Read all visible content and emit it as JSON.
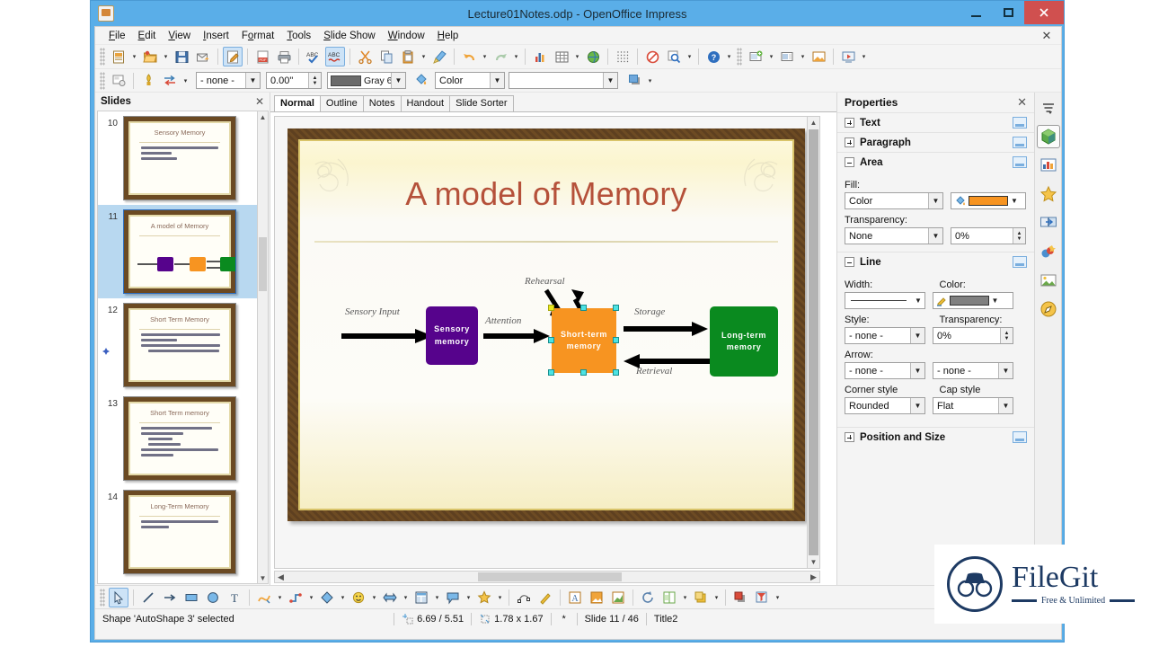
{
  "window": {
    "title": "Lecture01Notes.odp - OpenOffice Impress",
    "app_icon": "impress-icon",
    "minimize": "–",
    "maximize": "□",
    "close": "✕"
  },
  "menubar": {
    "items": [
      {
        "label": "File",
        "mnemonic": "F"
      },
      {
        "label": "Edit",
        "mnemonic": "E"
      },
      {
        "label": "View",
        "mnemonic": "V"
      },
      {
        "label": "Insert",
        "mnemonic": "I"
      },
      {
        "label": "Format",
        "mnemonic": "o"
      },
      {
        "label": "Tools",
        "mnemonic": "T"
      },
      {
        "label": "Slide Show",
        "mnemonic": "S"
      },
      {
        "label": "Window",
        "mnemonic": "W"
      },
      {
        "label": "Help",
        "mnemonic": "H"
      }
    ],
    "close_label": "✕"
  },
  "standard_toolbar": {
    "buttons": [
      {
        "name": "new-document",
        "has_dropdown": true
      },
      {
        "name": "open-document",
        "has_dropdown": true
      },
      {
        "name": "save-document",
        "has_dropdown": false
      },
      {
        "name": "email-document",
        "has_dropdown": false
      },
      {
        "name": "edit-file",
        "has_dropdown": false,
        "active": true
      },
      {
        "name": "export-pdf",
        "has_dropdown": false
      },
      {
        "name": "print-file",
        "has_dropdown": false
      },
      {
        "name": "spelling",
        "has_dropdown": false
      },
      {
        "name": "autospellcheck",
        "has_dropdown": false,
        "active": true
      },
      {
        "name": "cut",
        "has_dropdown": false
      },
      {
        "name": "copy",
        "has_dropdown": false
      },
      {
        "name": "paste",
        "has_dropdown": true
      },
      {
        "name": "clone-formatting",
        "has_dropdown": false
      },
      {
        "name": "undo",
        "has_dropdown": true
      },
      {
        "name": "redo",
        "has_dropdown": true,
        "disabled": true
      },
      {
        "name": "insert-chart",
        "has_dropdown": false
      },
      {
        "name": "insert-table",
        "has_dropdown": true
      },
      {
        "name": "insert-image",
        "has_dropdown": false
      },
      {
        "name": "display-grid",
        "has_dropdown": false
      },
      {
        "name": "display-views",
        "has_dropdown": false
      },
      {
        "name": "zoom",
        "has_dropdown": true
      },
      {
        "name": "help",
        "has_dropdown": false
      },
      {
        "name": "new-slide",
        "has_dropdown": true
      },
      {
        "name": "slide-layout",
        "has_dropdown": true
      },
      {
        "name": "slide-design",
        "has_dropdown": false
      },
      {
        "name": "start-slideshow",
        "has_dropdown": false
      }
    ]
  },
  "line_fill_toolbar": {
    "buttons": [
      {
        "name": "slide-properties"
      },
      {
        "name": "fontwork"
      },
      {
        "name": "interaction",
        "has_dropdown": true
      }
    ],
    "line_style_value": "- none -",
    "line_width_value": "0.00\"",
    "line_color_value": "Gray 6",
    "area_style_value": "Color",
    "area_fill_value": "",
    "shadow_button": "shadow-icon"
  },
  "slides_panel": {
    "title": "Slides",
    "close_label": "✕",
    "slides": [
      {
        "number": "10",
        "title": "Sensory Memory",
        "selected": false,
        "bullets": [
          {
            "indent": 0,
            "width": 96
          },
          {
            "indent": 0,
            "width": 38
          },
          {
            "indent": 0,
            "width": 44
          }
        ]
      },
      {
        "number": "11",
        "title": "A model of Memory",
        "selected": true,
        "has_diagram": true,
        "bullets": []
      },
      {
        "number": "12",
        "title": "Short Term Memory",
        "selected": false,
        "has_marker": true,
        "bullets": [
          {
            "indent": 0,
            "width": 98
          },
          {
            "indent": 0,
            "width": 44
          },
          {
            "indent": 0,
            "width": 98
          },
          {
            "indent": 0,
            "width": 92
          }
        ]
      },
      {
        "number": "13",
        "title": "Short Term memory",
        "selected": false,
        "bullets": [
          {
            "indent": 0,
            "width": 88
          },
          {
            "indent": 0,
            "width": 52
          },
          {
            "indent": 1,
            "width": 30
          },
          {
            "indent": 1,
            "width": 40
          },
          {
            "indent": 0,
            "width": 96
          },
          {
            "indent": 0,
            "width": 40
          }
        ]
      },
      {
        "number": "14",
        "title": "Long-Term Memory",
        "selected": false,
        "bullets": [
          {
            "indent": 0,
            "width": 96
          },
          {
            "indent": 0,
            "width": 34
          }
        ]
      }
    ]
  },
  "view_tabs": {
    "tabs": [
      {
        "label": "Normal",
        "active": true
      },
      {
        "label": "Outline",
        "active": false
      },
      {
        "label": "Notes",
        "active": false
      },
      {
        "label": "Handout",
        "active": false
      },
      {
        "label": "Slide Sorter",
        "active": false
      }
    ]
  },
  "slide": {
    "title": "A model of Memory",
    "title_color": "#b5513a",
    "boxes": [
      {
        "name": "sensory-memory-box",
        "label": "Sensory\nmemory",
        "color": "#56038c"
      },
      {
        "name": "short-term-memory-box",
        "label": "Short-term\nmemory",
        "color": "#f79421",
        "selected": true
      },
      {
        "name": "long-term-memory-box",
        "label": "Long-term\nmemory",
        "color": "#0a8a1f"
      }
    ],
    "labels": [
      {
        "name": "sensory-input-label",
        "text": "Sensory Input"
      },
      {
        "name": "attention-label",
        "text": "Attention"
      },
      {
        "name": "rehearsal-label",
        "text": "Rehearsal"
      },
      {
        "name": "storage-label",
        "text": "Storage"
      },
      {
        "name": "retrieval-label",
        "text": "Retrieval"
      }
    ]
  },
  "properties": {
    "title": "Properties",
    "close_label": "✕",
    "sections": [
      {
        "label": "Text",
        "expanded": false
      },
      {
        "label": "Paragraph",
        "expanded": false
      },
      {
        "label": "Area",
        "expanded": true
      },
      {
        "label": "Line",
        "expanded": true
      },
      {
        "label": "Position and Size",
        "expanded": false
      }
    ],
    "area": {
      "fill_label": "Fill:",
      "fill_value": "Color",
      "fill_color": "#f79421",
      "transparency_label": "Transparency:",
      "transparency_value": "None",
      "transparency_percent": "0%"
    },
    "line": {
      "width_label": "Width:",
      "color_label": "Color:",
      "line_color": "#808080",
      "style_label": "Style:",
      "style_value": "- none -",
      "transparency_label": "Transparency:",
      "transparency_percent": "0%",
      "arrow_label": "Arrow:",
      "arrow_start_value": "- none -",
      "arrow_end_value": "- none -",
      "corner_style_label": "Corner style",
      "corner_style_value": "Rounded",
      "cap_style_label": "Cap style",
      "cap_style_value": "Flat"
    }
  },
  "sidebar_strip": {
    "buttons": [
      {
        "name": "sidebar-settings-icon"
      },
      {
        "name": "properties-icon",
        "selected": true
      },
      {
        "name": "master-slides-icon"
      },
      {
        "name": "styles-icon"
      },
      {
        "name": "slide-transition-icon"
      },
      {
        "name": "custom-animation-icon"
      },
      {
        "name": "gallery-icon"
      },
      {
        "name": "navigator-icon"
      }
    ]
  },
  "drawing_toolbar": {
    "buttons": [
      {
        "name": "select-tool",
        "active": true
      },
      {
        "name": "line-tool"
      },
      {
        "name": "line-ends-arrow-tool"
      },
      {
        "name": "rectangle-tool"
      },
      {
        "name": "ellipse-tool"
      },
      {
        "name": "text-box-tool"
      },
      {
        "name": "curve-tool",
        "has_dropdown": true
      },
      {
        "name": "connector-tool",
        "has_dropdown": true
      },
      {
        "name": "basic-shapes-tool",
        "has_dropdown": true
      },
      {
        "name": "symbol-shapes-tool",
        "has_dropdown": true
      },
      {
        "name": "block-arrows-tool",
        "has_dropdown": true
      },
      {
        "name": "flowchart-tool",
        "has_dropdown": true
      },
      {
        "name": "callouts-tool",
        "has_dropdown": true
      },
      {
        "name": "stars-tool",
        "has_dropdown": true
      },
      {
        "name": "points-tool"
      },
      {
        "name": "glue-points-tool"
      },
      {
        "name": "fontwork-gallery-tool"
      },
      {
        "name": "insert-image-tool"
      },
      {
        "name": "insert-chart-tool"
      },
      {
        "name": "rotate-tool"
      },
      {
        "name": "alignment-tool",
        "has_dropdown": true
      },
      {
        "name": "arrange-tool",
        "has_dropdown": true
      },
      {
        "name": "shadow-tool"
      },
      {
        "name": "filter-tool"
      }
    ]
  },
  "statusbar": {
    "selection_text": "Shape 'AutoShape 3' selected",
    "position_value": "6.69 / 5.51",
    "size_value": "1.78 x 1.67",
    "modified_value": "*",
    "slide_value": "Slide 11 / 46",
    "layout_value": "Title2",
    "zoom_out": "⊖",
    "zoom_in": "⊕"
  },
  "watermark": {
    "name": "FileGit",
    "tagline": "Free & Unlimited"
  }
}
